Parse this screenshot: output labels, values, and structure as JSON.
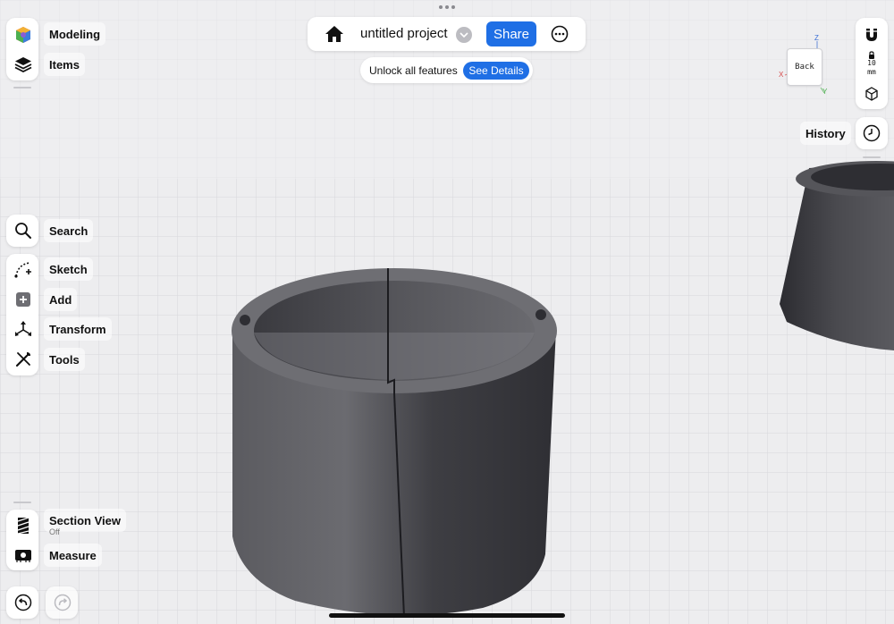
{
  "top_bar": {
    "project_name": "untitled project",
    "share_label": "Share"
  },
  "banner": {
    "text": "Unlock all features",
    "button_label": "See Details"
  },
  "left_toolbar": {
    "modeling": "Modeling",
    "items": "Items",
    "search": "Search",
    "sketch": "Sketch",
    "add": "Add",
    "transform": "Transform",
    "tools": "Tools",
    "section_view": "Section View",
    "section_view_state": "Off",
    "measure": "Measure"
  },
  "right_toolbar": {
    "grid_size_value": "10",
    "grid_size_unit": "mm",
    "history": "History"
  },
  "view_cube": {
    "face_label": "Back",
    "axis_x": "X",
    "axis_y": "Y",
    "axis_z": "Z"
  },
  "colors": {
    "accent": "#1f6fe5",
    "model": "#4a4a4f",
    "background": "#ededef"
  }
}
